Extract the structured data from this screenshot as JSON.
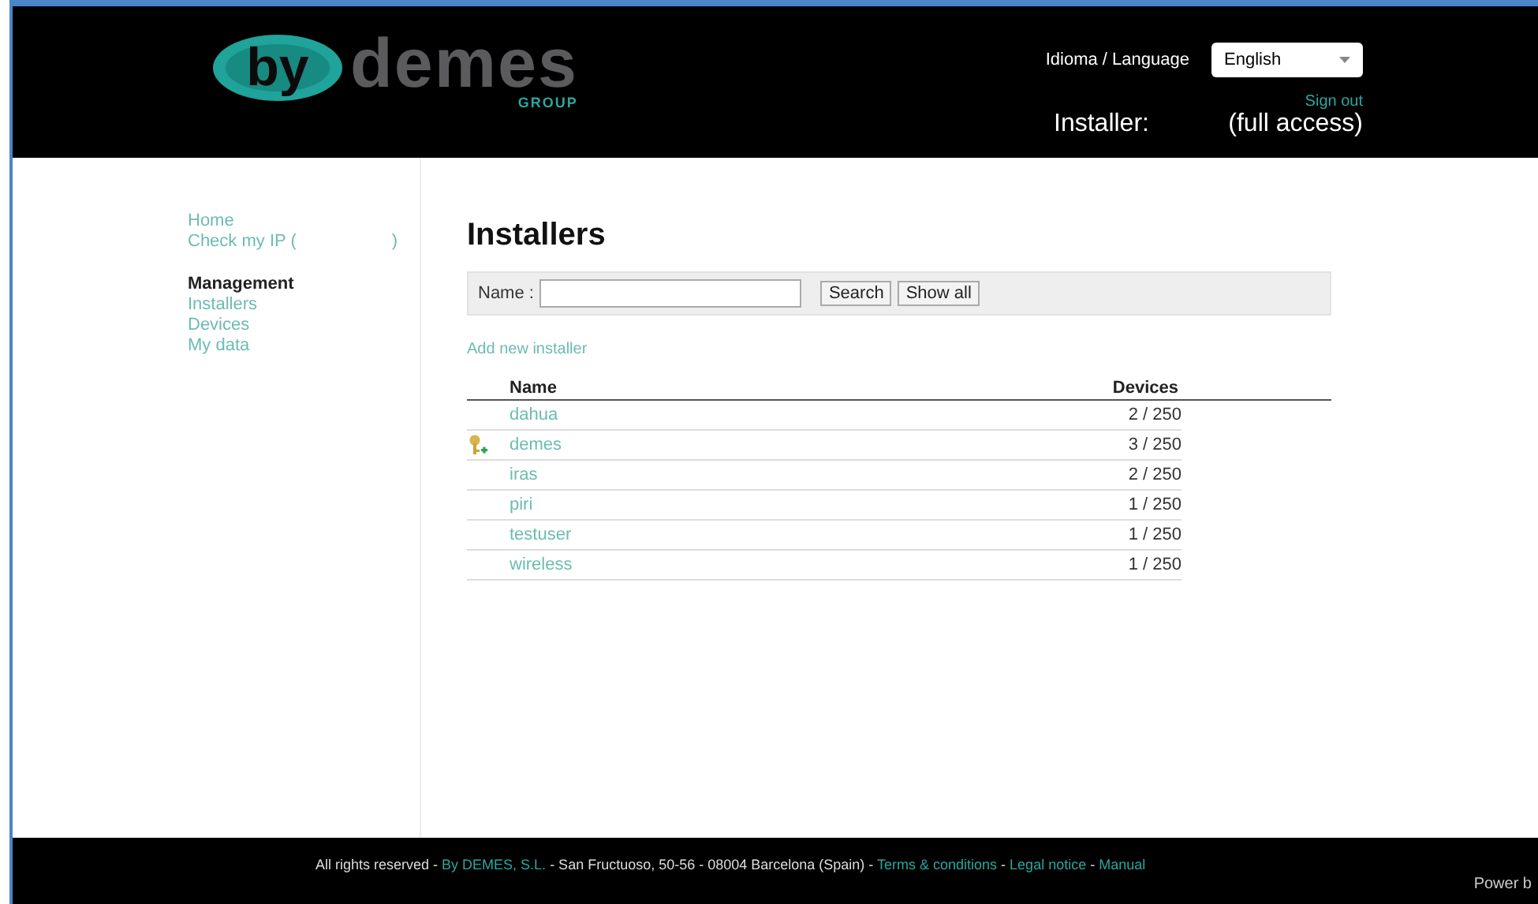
{
  "header": {
    "logo": {
      "mark": "by",
      "name": "demes",
      "group": "GROUP"
    },
    "language_label": "Idioma / Language",
    "language": {
      "value": "English"
    },
    "sign_out": "Sign out",
    "user_label": "Installer:",
    "user_access": "(full access)"
  },
  "sidebar": {
    "top_links": [
      {
        "label": "Home"
      },
      {
        "label": "Check my IP (",
        "tail": ")"
      }
    ],
    "section": "Management",
    "links": [
      {
        "label": "Installers"
      },
      {
        "label": "Devices"
      },
      {
        "label": "My data"
      }
    ]
  },
  "main": {
    "title": "Installers",
    "search": {
      "label": "Name :",
      "buttons": [
        "Search",
        "Show all"
      ]
    },
    "add_link": "Add new installer",
    "table": {
      "columns": [
        "Name",
        "Devices"
      ],
      "rows": [
        {
          "kind": "plain",
          "name": "dahua",
          "devices": "2 / 250"
        },
        {
          "kind": "owner",
          "name": "demes",
          "devices": "3 / 250"
        },
        {
          "kind": "plain",
          "name": "iras",
          "devices": "2 / 250"
        },
        {
          "kind": "plain",
          "name": "piri",
          "devices": "1 / 250"
        },
        {
          "kind": "plain",
          "name": "testuser",
          "devices": "1 / 250"
        },
        {
          "kind": "plain",
          "name": "wireless",
          "devices": "1 / 250"
        }
      ]
    }
  },
  "footer": {
    "parts": [
      {
        "kind": "text",
        "text": "All rights reserved - "
      },
      {
        "kind": "link",
        "text": "By DEMES, S.L."
      },
      {
        "kind": "text",
        "text": " - San Fructuoso, 50-56 - 08004 Barcelona (Spain) - "
      },
      {
        "kind": "link",
        "text": "Terms & conditions"
      },
      {
        "kind": "text",
        "text": " - "
      },
      {
        "kind": "link",
        "text": "Legal notice"
      },
      {
        "kind": "text",
        "text": " - "
      },
      {
        "kind": "link",
        "text": "Manual"
      }
    ],
    "powered": "Power b"
  }
}
